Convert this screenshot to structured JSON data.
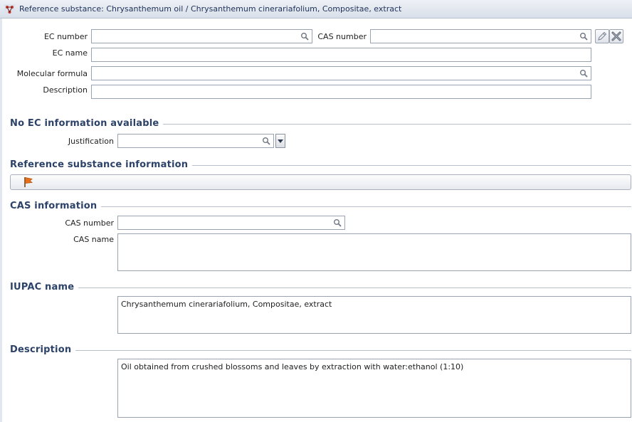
{
  "window": {
    "title": "Reference substance: Chrysanthemum oil / Chrysanthemum cinerariafolium, Compositae, extract"
  },
  "identity": {
    "ec_number_label": "EC number",
    "ec_number_value": "",
    "cas_number_label": "CAS number",
    "cas_number_value": "",
    "ec_name_label": "EC name",
    "ec_name_value": "",
    "molecular_formula_label": "Molecular formula",
    "molecular_formula_value": "",
    "description_label": "Description",
    "description_value": ""
  },
  "no_ec": {
    "title": "No EC information available",
    "justification_label": "Justification",
    "justification_value": ""
  },
  "ref_info": {
    "title": "Reference substance information"
  },
  "cas_info": {
    "title": "CAS information",
    "cas_number_label": "CAS number",
    "cas_number_value": "",
    "cas_name_label": "CAS name",
    "cas_name_value": ""
  },
  "iupac": {
    "title": "IUPAC name",
    "value": "Chrysanthemum cinerariafolium, Compositae, extract"
  },
  "description": {
    "title": "Description",
    "value": "Oil obtained from crushed blossoms and leaves by extraction with water:ethanol (1:10)"
  },
  "icons": {
    "title": "molecule-icon",
    "search": "magnifier-icon",
    "edit": "pencil-icon",
    "clear": "delete-x-icon",
    "flag": "flag-icon"
  },
  "colors": {
    "section_title": "#2c4268",
    "title_text": "#1e3158",
    "flag": "#e8701a"
  }
}
